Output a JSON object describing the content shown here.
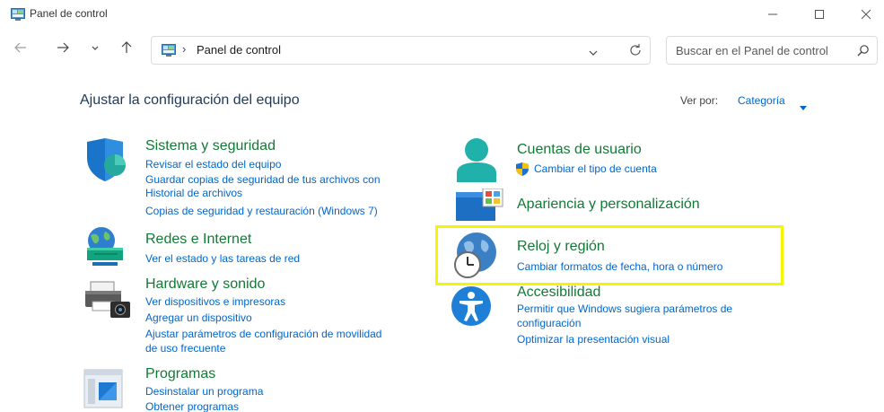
{
  "window": {
    "title": "Panel de control"
  },
  "nav": {
    "address": "Panel de control",
    "search_placeholder": "Buscar en el Panel de control"
  },
  "main": {
    "title": "Ajustar la configuración del equipo",
    "view_by_label": "Ver por:",
    "view_by_value": "Categoría"
  },
  "categories": {
    "sistema": {
      "title": "Sistema y seguridad",
      "links": [
        "Revisar el estado del equipo",
        "Guardar copias de seguridad de tus archivos con",
        "Historial de archivos",
        "Copias de seguridad y restauración (Windows 7)"
      ]
    },
    "redes": {
      "title": "Redes e Internet",
      "links": [
        "Ver el estado y las tareas de red"
      ]
    },
    "hardware": {
      "title": "Hardware y sonido",
      "links": [
        "Ver dispositivos e impresoras",
        "Agregar un dispositivo",
        "Ajustar parámetros de configuración de movilidad",
        "de uso frecuente"
      ]
    },
    "programas": {
      "title": "Programas",
      "links": [
        "Desinstalar un programa",
        "Obtener programas"
      ]
    },
    "cuentas": {
      "title": "Cuentas de usuario",
      "links": [
        "Cambiar el tipo de cuenta"
      ]
    },
    "apariencia": {
      "title": "Apariencia y personalización",
      "links": []
    },
    "reloj": {
      "title": "Reloj y región",
      "links": [
        "Cambiar formatos de fecha, hora o número"
      ]
    },
    "accesibilidad": {
      "title": "Accesibilidad",
      "links": [
        "Permitir que Windows sugiera parámetros de",
        "configuración",
        "Optimizar la presentación visual"
      ]
    }
  },
  "colors": {
    "category_title": "#117a34",
    "link": "#0066cc",
    "highlight": "#f5f500"
  }
}
